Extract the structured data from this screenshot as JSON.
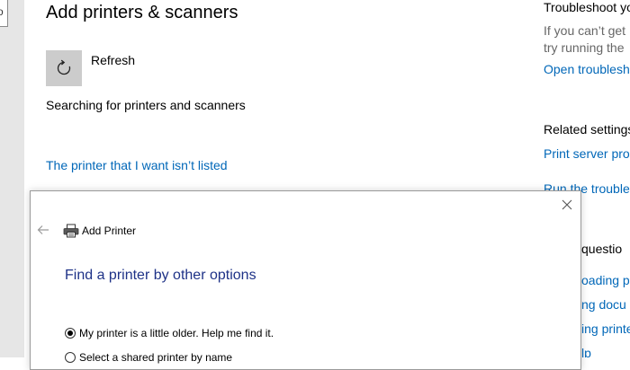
{
  "settings": {
    "page_title": "Add printers & scanners",
    "refresh_label": "Refresh",
    "status_text": "Searching for printers and scanners",
    "not_listed_link": "The printer that I want isn’t listed"
  },
  "right_column": {
    "troubleshoot_heading": "Troubleshoot yo",
    "troubleshoot_text_1": "If you can’t get",
    "troubleshoot_text_2": "try running the",
    "open_troubleshooter_link": "Open troublesh",
    "related_settings_heading": "Related settings",
    "print_server_link": "Print server prop",
    "run_troubleshooter_link": "Run the trouble",
    "questions_heading": "questio",
    "link_downloading": "oading pr",
    "link_documents": "ng docu",
    "link_printers": "ing printe",
    "link_help": "lp"
  },
  "dialog": {
    "title": "Add Printer",
    "heading": "Find a printer by other options",
    "options": [
      {
        "label": "My printer is a little older. Help me find it.",
        "selected": true
      },
      {
        "label": "Select a shared printer by name",
        "selected": false
      }
    ]
  },
  "icons": {
    "refresh": "refresh-icon",
    "back": "back-arrow-icon",
    "close": "close-icon",
    "printer": "printer-icon"
  },
  "colors": {
    "link": "#0067b8",
    "dialog_heading": "#1e3287",
    "tile": "#cccccc"
  }
}
